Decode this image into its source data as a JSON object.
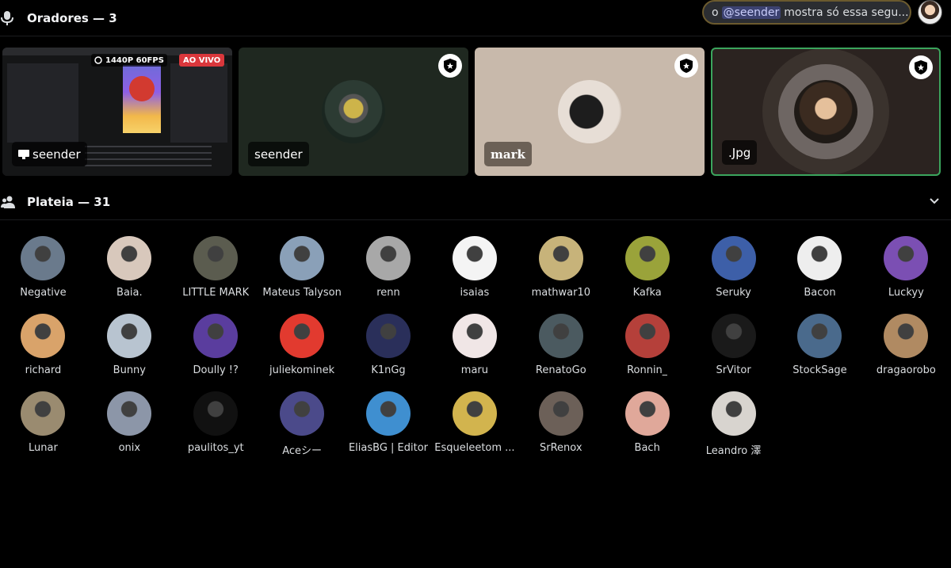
{
  "speakers": {
    "title": "Oradores — 3"
  },
  "chat": {
    "prefix": "o",
    "mention": "@seender",
    "message": "mostra só essa segu..."
  },
  "tiles": {
    "stream": {
      "quality": "1440P 60FPS",
      "live": "AO VIVO",
      "name": "seender"
    },
    "seender": {
      "name": "seender"
    },
    "mark": {
      "name": "mark"
    },
    "jpg": {
      "name": ".Jpg"
    }
  },
  "audience": {
    "title": "Plateia — 31",
    "members": [
      {
        "name": "Negative",
        "color": "#6a7a8c"
      },
      {
        "name": "Baia.",
        "color": "#d8c8bc"
      },
      {
        "name": "LITTLE MARK",
        "color": "#5b5c4f"
      },
      {
        "name": "Mateus Talyson",
        "color": "#8aa0b8"
      },
      {
        "name": "renn",
        "color": "#a8a8a8"
      },
      {
        "name": "isaias",
        "color": "#f4f4f4"
      },
      {
        "name": "mathwar10",
        "color": "#c7b37a"
      },
      {
        "name": "Kafka",
        "color": "#9aa33a"
      },
      {
        "name": "Seruky",
        "color": "#3d5fa8"
      },
      {
        "name": "Bacon",
        "color": "#eeeeee"
      },
      {
        "name": "Luckyy",
        "color": "#7b4fb3"
      },
      {
        "name": "richard",
        "color": "#d9a36a"
      },
      {
        "name": "Bunny",
        "color": "#b8c4d0"
      },
      {
        "name": "Doully !?",
        "color": "#5a3d9e"
      },
      {
        "name": "juliekominek",
        "color": "#e23a2f"
      },
      {
        "name": "K1nGg",
        "color": "#2a2f5a"
      },
      {
        "name": "maru",
        "color": "#f0e6e6"
      },
      {
        "name": "RenatoGo",
        "color": "#4b5a60"
      },
      {
        "name": "Ronnin_",
        "color": "#b5403a"
      },
      {
        "name": "SrVitor",
        "color": "#1a1a1a"
      },
      {
        "name": "StockSage",
        "color": "#4a6a8c"
      },
      {
        "name": "dragaorobo",
        "color": "#b08a62"
      },
      {
        "name": "Lunar",
        "color": "#9a8b70"
      },
      {
        "name": "onix",
        "color": "#8c96a8"
      },
      {
        "name": "paulitos_yt",
        "color": "#111111"
      },
      {
        "name": "Aceシー",
        "color": "#4b4a8a"
      },
      {
        "name": "EliasBG | Editor",
        "color": "#3f8fd0"
      },
      {
        "name": "Esqueleetom ...",
        "color": "#d2b44e"
      },
      {
        "name": "SrRenox",
        "color": "#6c6058"
      },
      {
        "name": "Bach",
        "color": "#e0a89a"
      },
      {
        "name": "Leandro 澤",
        "color": "#d8d4cf"
      }
    ]
  }
}
